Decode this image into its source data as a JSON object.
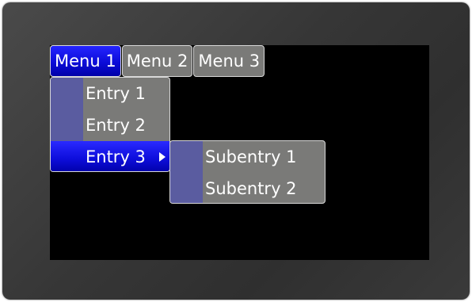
{
  "menubar": {
    "items": [
      {
        "label": "Menu 1",
        "active": true
      },
      {
        "label": "Menu 2",
        "active": false
      },
      {
        "label": "Menu 3",
        "active": false
      }
    ]
  },
  "dropdown": {
    "entries": [
      {
        "label": "Entry 1"
      },
      {
        "label": "Entry 2"
      },
      {
        "label": "Entry 3",
        "selected": true,
        "has_submenu": true,
        "submenu_icon": "play-arrow-icon"
      }
    ]
  },
  "submenu": {
    "entries": [
      {
        "label": "Subentry 1"
      },
      {
        "label": "Subentry 2"
      }
    ]
  },
  "colors": {
    "menu_background": "#7a7a78",
    "icon_stripe": "#5a5ca0",
    "highlight": "#1414e6",
    "screen": "#000000",
    "bezel": "#3a3a3a",
    "text": "#ffffff",
    "border": "#d8d8d8"
  }
}
